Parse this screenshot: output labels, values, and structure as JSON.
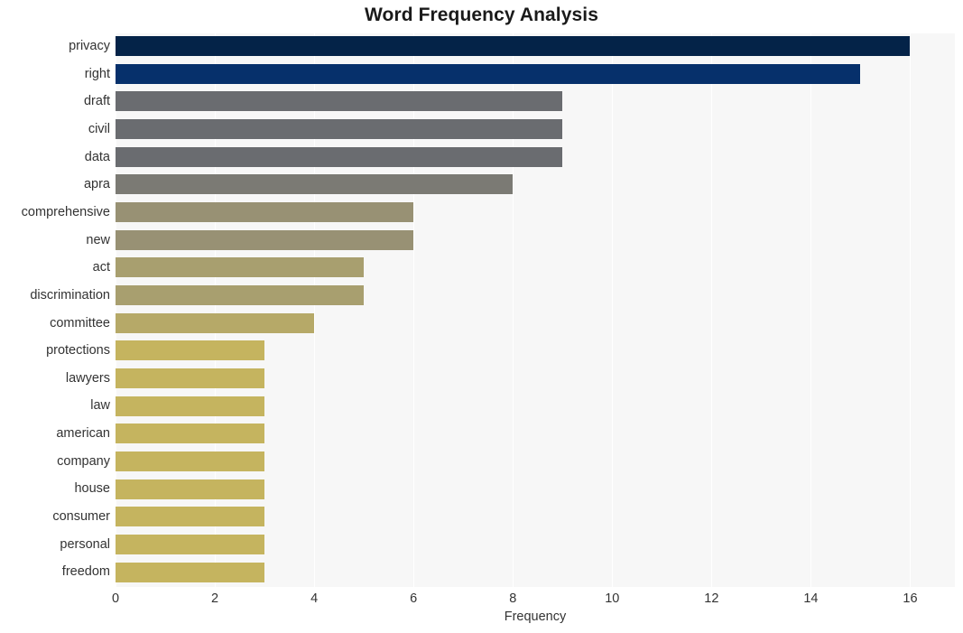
{
  "chart_data": {
    "type": "bar",
    "orientation": "horizontal",
    "title": "Word Frequency Analysis",
    "xlabel": "Frequency",
    "ylabel": "",
    "xlim": [
      0,
      16.9
    ],
    "xticks": [
      0,
      2,
      4,
      6,
      8,
      10,
      12,
      14,
      16
    ],
    "xtick_labels": [
      "0",
      "2",
      "4",
      "6",
      "8",
      "10",
      "12",
      "14",
      "16"
    ],
    "grid": "vertical-white-on-light-gray",
    "legend": "none",
    "categories": [
      "privacy",
      "right",
      "draft",
      "civil",
      "data",
      "apra",
      "comprehensive",
      "new",
      "act",
      "discrimination",
      "committee",
      "protections",
      "lawyers",
      "law",
      "american",
      "company",
      "house",
      "consumer",
      "personal",
      "freedom"
    ],
    "values": [
      16,
      15,
      9,
      9,
      9,
      8,
      6,
      6,
      5,
      5,
      4,
      3,
      3,
      3,
      3,
      3,
      3,
      3,
      3,
      3
    ],
    "bar_colors": [
      "#042348",
      "#06306b",
      "#6a6c70",
      "#6a6c70",
      "#6a6c70",
      "#7b7a74",
      "#989174",
      "#989174",
      "#a89f6f",
      "#a89f6f",
      "#b6a968",
      "#c5b45f",
      "#c5b45f",
      "#c5b45f",
      "#c5b45f",
      "#c5b45f",
      "#c5b45f",
      "#c5b45f",
      "#c5b45f",
      "#c5b45f"
    ],
    "plot_background": "#f7f7f7",
    "figure_background": "#ffffff",
    "gridline_color": "#ffffff",
    "text_color": "#333333",
    "title_color": "#1a1a1a"
  }
}
